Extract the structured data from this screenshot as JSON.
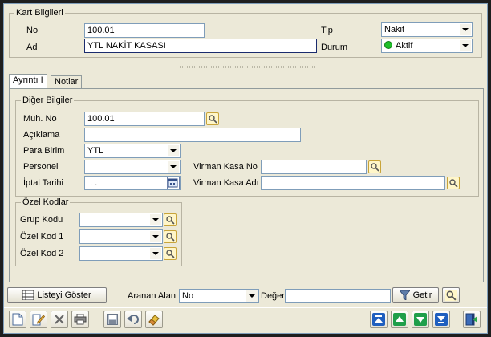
{
  "kart": {
    "title": "Kart Bilgileri",
    "no_label": "No",
    "no_value": "100.01",
    "ad_label": "Ad",
    "ad_value": "YTL NAKİT  KASASI",
    "tip_label": "Tip",
    "tip_value": "Nakit",
    "durum_label": "Durum",
    "durum_value": "Aktif"
  },
  "tabs": [
    {
      "label": "Ayrıntı I"
    },
    {
      "label": "Notlar"
    }
  ],
  "diger": {
    "title": "Diğer Bilgiler",
    "muh_no_label": "Muh. No",
    "muh_no_value": "100.01",
    "aciklama_label": "Açıklama",
    "aciklama_value": "",
    "para_birim_label": "Para Birim",
    "para_birim_value": "YTL",
    "personel_label": "Personel",
    "personel_value": "",
    "iptal_tarihi_label": "İptal Tarihi",
    "iptal_tarihi_value": " .  .",
    "virman_kasa_no_label": "Virman Kasa No",
    "virman_kasa_no_value": "",
    "virman_kasa_adi_label": "Virman Kasa Adı",
    "virman_kasa_adi_value": ""
  },
  "ozel": {
    "title": "Özel Kodlar",
    "grup_kodu_label": "Grup Kodu",
    "ozel_kod1_label": "Özel Kod 1",
    "ozel_kod2_label": "Özel Kod 2"
  },
  "search": {
    "list_button": "Listeyi Göster",
    "aranan_alan_label": "Aranan Alan",
    "aranan_alan_value": "No",
    "deger_label": "Değer",
    "deger_value": "",
    "getir_button": "Getir"
  },
  "colors": {
    "status_active": "#1fbf2a",
    "nav_green": "#1f9f4a",
    "nav_blue": "#1f5fbf"
  },
  "icons": {
    "toolbar": [
      "new-icon",
      "edit-icon",
      "delete-icon",
      "print-icon",
      "save-icon",
      "undo-icon",
      "eraser-icon"
    ],
    "nav": [
      "first-record-icon",
      "previous-record-icon",
      "next-record-icon",
      "last-record-icon",
      "exit-icon"
    ]
  }
}
